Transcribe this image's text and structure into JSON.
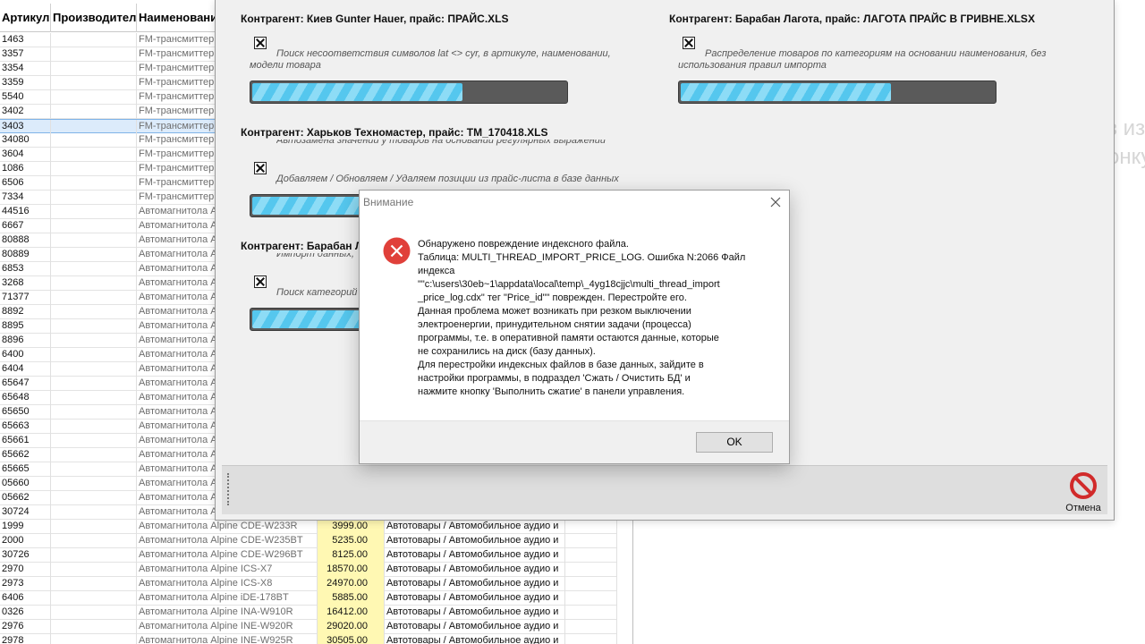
{
  "grid": {
    "headers": {
      "article": "Артикул",
      "manufacturer": "Производитель",
      "name": "Наименование"
    },
    "rows": [
      {
        "article": "1463",
        "name": "FM-трансмиттер",
        "price": "",
        "category": ""
      },
      {
        "article": "3357",
        "name": "FM-трансмиттер",
        "price": "",
        "category": ""
      },
      {
        "article": "3354",
        "name": "FM-трансмиттер",
        "price": "",
        "category": ""
      },
      {
        "article": "3359",
        "name": "FM-трансмиттер",
        "price": "",
        "category": ""
      },
      {
        "article": "5540",
        "name": "FM-трансмиттер",
        "price": "",
        "category": ""
      },
      {
        "article": "3402",
        "name": "FM-трансмиттер",
        "price": "",
        "category": ""
      },
      {
        "article": "3403",
        "name": "FM-трансмиттер",
        "price": "",
        "category": "",
        "selected": true
      },
      {
        "article": "34080",
        "name": "FM-трансмиттер",
        "price": "",
        "category": ""
      },
      {
        "article": "3604",
        "name": "FM-трансмиттер",
        "price": "",
        "category": ""
      },
      {
        "article": "1086",
        "name": "FM-трансмиттер",
        "price": "",
        "category": ""
      },
      {
        "article": "6506",
        "name": "FM-трансмиттер",
        "price": "",
        "category": ""
      },
      {
        "article": "7334",
        "name": "FM-трансмиттер",
        "price": "",
        "category": ""
      },
      {
        "article": "44516",
        "name": "Автомагнитола А",
        "price": "",
        "category": ""
      },
      {
        "article": "6667",
        "name": "Автомагнитола А",
        "price": "",
        "category": ""
      },
      {
        "article": "80888",
        "name": "Автомагнитола А",
        "price": "",
        "category": ""
      },
      {
        "article": "80889",
        "name": "Автомагнитола А",
        "price": "",
        "category": ""
      },
      {
        "article": "6853",
        "name": "Автомагнитола А",
        "price": "",
        "category": ""
      },
      {
        "article": "3268",
        "name": "Автомагнитола А",
        "price": "",
        "category": ""
      },
      {
        "article": "71377",
        "name": "Автомагнитола А",
        "price": "",
        "category": ""
      },
      {
        "article": "8892",
        "name": "Автомагнитола А",
        "price": "",
        "category": ""
      },
      {
        "article": "8895",
        "name": "Автомагнитола А",
        "price": "",
        "category": ""
      },
      {
        "article": "8896",
        "name": "Автомагнитола А",
        "price": "",
        "category": ""
      },
      {
        "article": "6400",
        "name": "Автомагнитола А",
        "price": "",
        "category": ""
      },
      {
        "article": "6404",
        "name": "Автомагнитола А",
        "price": "",
        "category": ""
      },
      {
        "article": "65647",
        "name": "Автомагнитола А",
        "price": "",
        "category": ""
      },
      {
        "article": "65648",
        "name": "Автомагнитола А",
        "price": "",
        "category": ""
      },
      {
        "article": "65650",
        "name": "Автомагнитола А",
        "price": "",
        "category": ""
      },
      {
        "article": "65663",
        "name": "Автомагнитола А",
        "price": "",
        "category": ""
      },
      {
        "article": "65661",
        "name": "Автомагнитола А",
        "price": "",
        "category": ""
      },
      {
        "article": "65662",
        "name": "Автомагнитола А",
        "price": "",
        "category": ""
      },
      {
        "article": "65665",
        "name": "Автомагнитола А",
        "price": "",
        "category": ""
      },
      {
        "article": "05660",
        "name": "Автомагнитола А",
        "price": "",
        "category": ""
      },
      {
        "article": "05662",
        "name": "Автомагнитола А",
        "price": "",
        "category": ""
      },
      {
        "article": "30724",
        "name": "Автомагнитола А",
        "price": "",
        "category": ""
      },
      {
        "article": "1999",
        "name": "Автомагнитола Alpine CDE-W233R",
        "price": "3999.00",
        "category": "Автотовары / Автомобильное аудио и"
      },
      {
        "article": "2000",
        "name": "Автомагнитола Alpine CDE-W235BT",
        "price": "5235.00",
        "category": "Автотовары / Автомобильное аудио и"
      },
      {
        "article": "30726",
        "name": "Автомагнитола Alpine CDE-W296BT",
        "price": "8125.00",
        "category": "Автотовары / Автомобильное аудио и"
      },
      {
        "article": "2970",
        "name": "Автомагнитола Alpine ICS-X7",
        "price": "18570.00",
        "category": "Автотовары / Автомобильное аудио и"
      },
      {
        "article": "2973",
        "name": "Автомагнитола Alpine ICS-X8",
        "price": "24970.00",
        "category": "Автотовары / Автомобильное аудио и"
      },
      {
        "article": "6406",
        "name": "Автомагнитола Alpine iDE-178BT",
        "price": "5885.00",
        "category": "Автотовары / Автомобильное аудио и"
      },
      {
        "article": "0326",
        "name": "Автомагнитола Alpine INA-W910R",
        "price": "16412.00",
        "category": "Автотовары / Автомобильное аудио и"
      },
      {
        "article": "2976",
        "name": "Автомагнитола Alpine INE-W920R",
        "price": "29020.00",
        "category": "Автотовары / Автомобильное аудио и"
      },
      {
        "article": "2978",
        "name": "Автомагнитола Alpine INE-W925R",
        "price": "30505.00",
        "category": "Автотовары / Автомобильное аудио и"
      }
    ]
  },
  "ghost_text": {
    "line1": "з из",
    "line2": "онку"
  },
  "import_window": {
    "panels": [
      {
        "title": "Контрагент: Киев Gunter Hauer, прайс: ПРАЙС.XLS",
        "status_lines": [
          "Поиск несоответствия символов lat <> cyr, в артикуле, наименовании,",
          "модели товара"
        ],
        "progress": 0.67
      },
      {
        "title": "Контрагент: Барабан Лагота, прайс: ЛАГОТА ПРАЙС В ГРИВНЕ.XLSX",
        "status_lines": [
          "Распределение товаров по категориям на основании наименования, без",
          "использования правил импорта"
        ],
        "progress": 0.67
      },
      {
        "title": "Контрагент: Харьков Техномастер, прайс: TM_170418.XLS",
        "status_prev": "Автозамена значений у товаров на основании регулярных выражений",
        "status_lines": [
          "Добавляем / Обновляем / Удаляем позиции из прайс-листа в базе данных"
        ],
        "progress": 0.67
      },
      {
        "title": "Контрагент: Барабан Л",
        "status_prev": "Импорт данных,",
        "status_lines": [
          "Поиск категорий"
        ],
        "progress": 0.67
      }
    ],
    "cancel_label": "Отмена"
  },
  "dialog": {
    "title": "Внимание",
    "lines": [
      "Обнаружено повреждение индексного файла.",
      "Таблица: MULTI_THREAD_IMPORT_PRICE_LOG. Ошибка N:2066 Файл",
      "индекса",
      "\"\"c:\\users\\30eb~1\\appdata\\local\\temp\\_4yg18cjjc\\multi_thread_import",
      "_price_log.cdx\" тег \"Price_id\"\" поврежден. Перестройте его.",
      "Данная проблема может возникать при резком выключении",
      "электроенергии, принудительном снятии задачи (процесса)",
      "программы, т.е. в оперативной памяти остаются данные, которые",
      "не сохранились на диск (базу данных).",
      "Для перестройки индексных файлов в базе данных, зайдите в",
      "настройки программы, в подраздел 'Сжать / Очистить БД' и",
      "нажмите кнопку 'Выполнить сжатие' в панели управления."
    ],
    "ok_label": "OK"
  },
  "colors": {
    "progress_fill": "#55c7ee",
    "progress_track": "#5a5a5a",
    "error_icon": "#e0403a",
    "cancel_icon": "#d12a2a",
    "price_cell": "#fff8b3",
    "selected_row": "#dcebfb"
  }
}
